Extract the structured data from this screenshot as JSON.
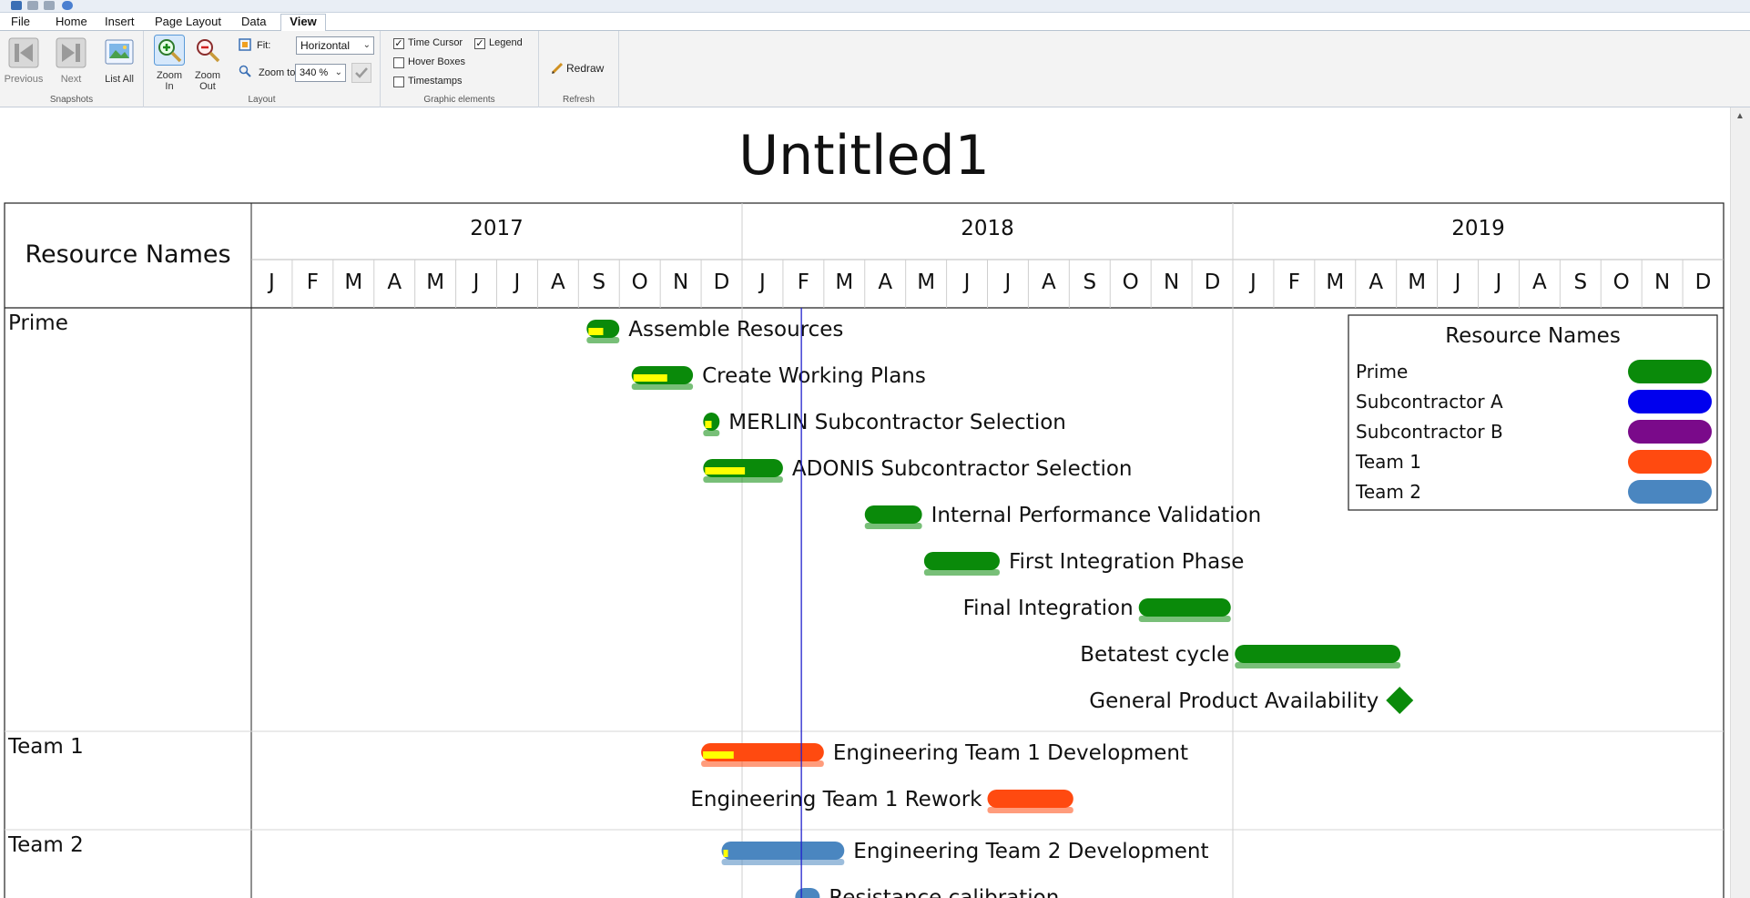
{
  "menu": {
    "tabs": [
      {
        "label": "File"
      },
      {
        "label": "Home"
      },
      {
        "label": "Insert"
      },
      {
        "label": "Page Layout"
      },
      {
        "label": "Data"
      },
      {
        "label": "View"
      }
    ],
    "active_tab": "View"
  },
  "ribbon": {
    "snapshots": {
      "group_label": "Snapshots",
      "previous_label": "Previous",
      "next_label": "Next",
      "list_all_label": "List All"
    },
    "layout": {
      "group_label": "Layout",
      "zoom_in_label": "Zoom In",
      "zoom_out_label": "Zoom Out",
      "fit_label": "Fit:",
      "fit_value": "Horizontal",
      "zoom_to_label": "Zoom to",
      "zoom_to_value": "340 %"
    },
    "graphic_elements": {
      "group_label": "Graphic elements",
      "time_cursor_label": "Time Cursor",
      "time_cursor_checked": true,
      "legend_label": "Legend",
      "legend_checked": true,
      "hover_boxes_label": "Hover Boxes",
      "hover_boxes_checked": false,
      "timestamps_label": "Timestamps",
      "timestamps_checked": false
    },
    "refresh": {
      "group_label": "Refresh",
      "redraw_label": "Redraw"
    }
  },
  "gantt": {
    "title": "Untitled1",
    "resource_column_header": "Resource Names",
    "years": [
      "2017",
      "2018",
      "2019"
    ],
    "months": [
      "J",
      "F",
      "M",
      "A",
      "M",
      "J",
      "J",
      "A",
      "S",
      "O",
      "N",
      "D"
    ],
    "time_cursor_month": 13.45,
    "colors": {
      "Prime": "#0a8a0a",
      "Subcontractor A": "#0000ee",
      "Subcontractor B": "#7a0a8a",
      "Team 1": "#ff4a10",
      "Team 2": "#4a86c0",
      "progress": "#ffff00",
      "cursor": "#2222cc"
    },
    "resources": [
      {
        "name": "Prime",
        "tasks": [
          {
            "label": "Assemble Resources",
            "start": 8.2,
            "end": 9.0,
            "progress": 0.45,
            "label_side": "right"
          },
          {
            "label": "Create Working Plans",
            "start": 9.3,
            "end": 10.8,
            "progress": 0.55,
            "label_side": "right"
          },
          {
            "label": "MERLIN Subcontractor Selection",
            "start": 11.05,
            "end": 11.45,
            "progress": 0.4,
            "label_side": "right"
          },
          {
            "label": "ADONIS Subcontractor Selection",
            "start": 11.05,
            "end": 13.0,
            "progress": 0.5,
            "label_side": "right"
          },
          {
            "label": "Internal Performance Validation",
            "start": 15.0,
            "end": 16.4,
            "progress": 0,
            "label_side": "right"
          },
          {
            "label": "First Integration Phase",
            "start": 16.45,
            "end": 18.3,
            "progress": 0,
            "label_side": "right"
          },
          {
            "label": "Final Integration",
            "start": 21.7,
            "end": 23.95,
            "progress": 0,
            "label_side": "left"
          },
          {
            "label": "Betatest cycle",
            "start": 24.05,
            "end": 28.1,
            "progress": 0,
            "label_side": "left"
          },
          {
            "label": "General Product Availability",
            "milestone": 28.08,
            "label_side": "left"
          }
        ]
      },
      {
        "name": "Team 1",
        "tasks": [
          {
            "label": "Engineering Team 1 Development",
            "start": 11.0,
            "end": 14.0,
            "progress": 0.25,
            "label_side": "right"
          },
          {
            "label": "Engineering Team 1 Rework",
            "start": 18.0,
            "end": 20.1,
            "progress": 0,
            "label_side": "left"
          }
        ]
      },
      {
        "name": "Team 2",
        "tasks": [
          {
            "label": "Engineering Team 2 Development",
            "start": 11.5,
            "end": 14.5,
            "progress": 0.03,
            "label_side": "right"
          },
          {
            "label": "Resistance calibration",
            "start": 13.3,
            "end": 13.9,
            "progress": 0,
            "label_side": "right"
          }
        ]
      }
    ],
    "legend": {
      "title": "Resource Names",
      "items": [
        {
          "name": "Prime",
          "color": "#0a8a0a"
        },
        {
          "name": "Subcontractor A",
          "color": "#0000ee"
        },
        {
          "name": "Subcontractor B",
          "color": "#7a0a8a"
        },
        {
          "name": "Team 1",
          "color": "#ff4a10"
        },
        {
          "name": "Team 2",
          "color": "#4a86c0"
        }
      ]
    }
  }
}
